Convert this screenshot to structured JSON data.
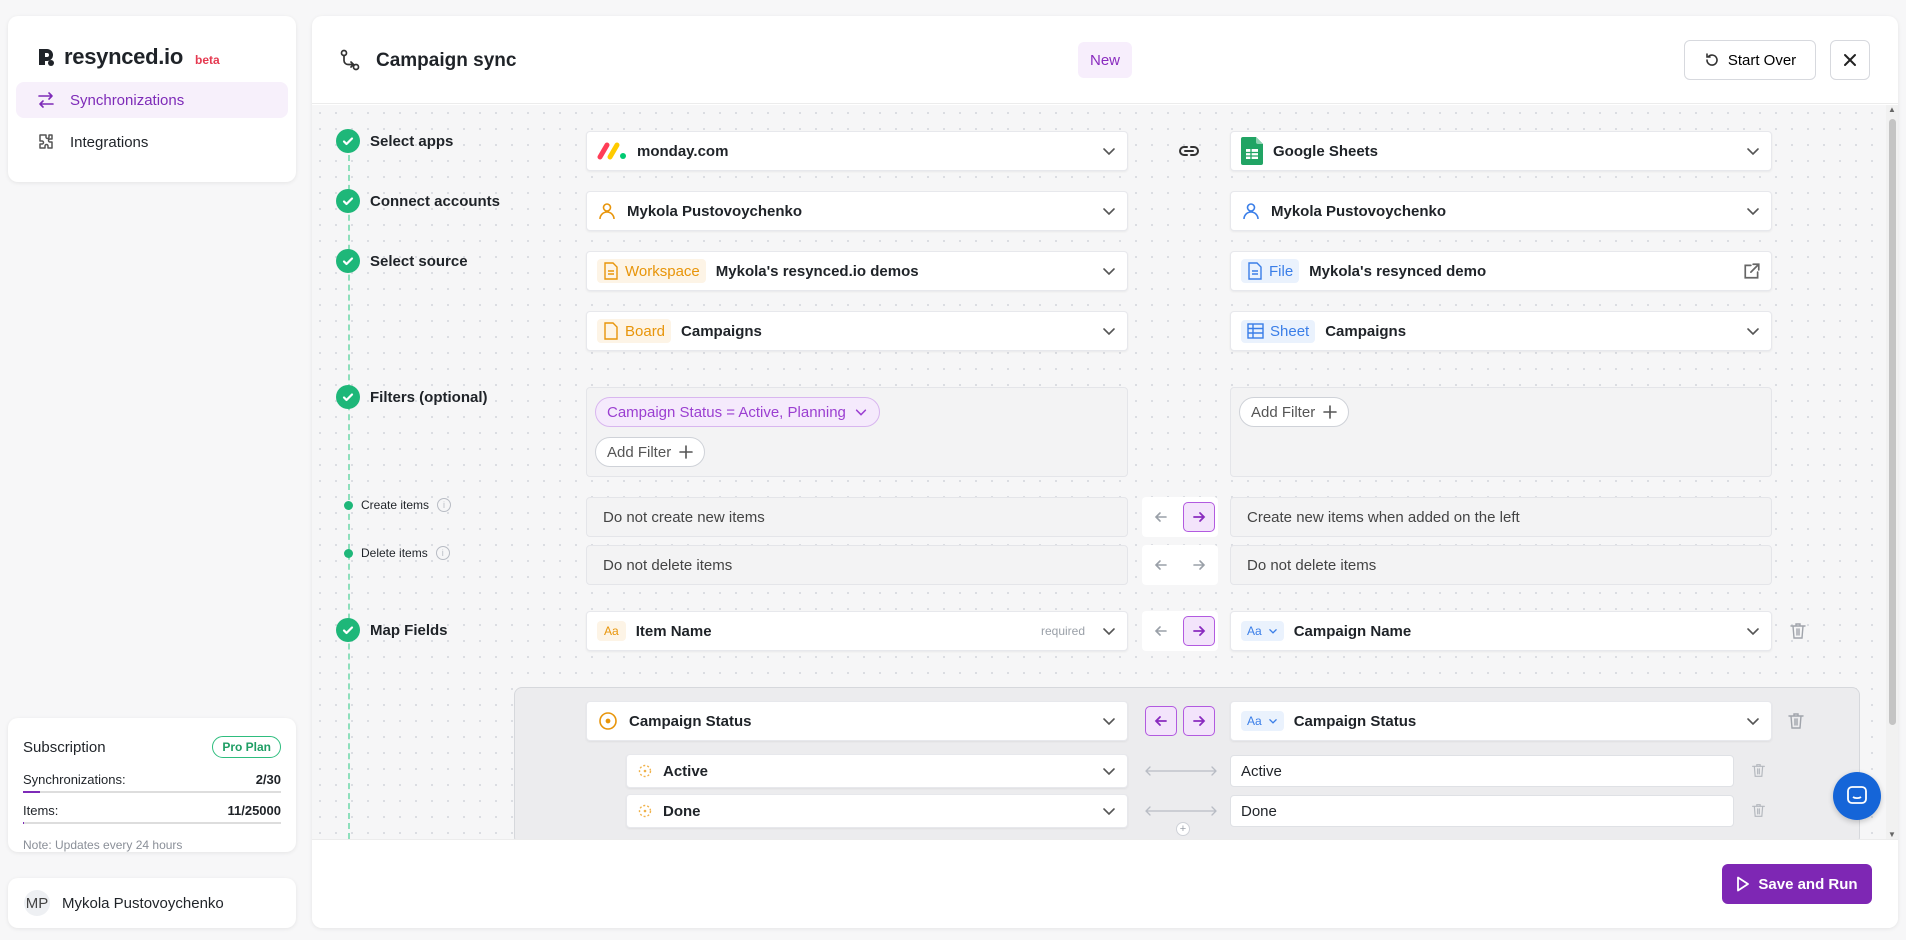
{
  "brand": {
    "name": "resynced.io",
    "beta": "beta",
    "accent": "#7e27b4"
  },
  "nav": [
    {
      "label": "Synchronizations",
      "icon": "sync-arrows-icon",
      "active": true
    },
    {
      "label": "Integrations",
      "icon": "puzzle-icon",
      "active": false
    }
  ],
  "subscription": {
    "title": "Subscription",
    "plan": "Pro Plan",
    "sync_label": "Synchronizations:",
    "sync_value": "2/30",
    "sync_progress": 0.067,
    "items_label": "Items:",
    "items_value": "11/25000",
    "items_progress": 0.0004,
    "note": "Note: Updates every 24 hours"
  },
  "user": {
    "initials": "MP",
    "name": "Mykola Pustovoychenko"
  },
  "header": {
    "title": "Campaign sync",
    "badge": "New",
    "start_over": "Start Over"
  },
  "steps": {
    "select_apps": "Select apps",
    "connect_accounts": "Connect accounts",
    "select_source": "Select source",
    "filters": "Filters (optional)",
    "create_items": "Create items",
    "delete_items": "Delete items",
    "map_fields": "Map Fields"
  },
  "left": {
    "app": "monday.com",
    "account": "Mykola Pustovoychenko",
    "workspace_tag": "Workspace",
    "workspace": "Mykola's resynced.io demos",
    "board_tag": "Board",
    "board": "Campaigns",
    "filter_chip": "Campaign Status = Active, Planning",
    "add_filter": "Add Filter",
    "create_option": "Do not create new items",
    "delete_option": "Do not delete items"
  },
  "right": {
    "app": "Google Sheets",
    "account": "Mykola Pustovoychenko",
    "file_tag": "File",
    "file": "Mykola's resynced demo",
    "sheet_tag": "Sheet",
    "sheet": "Campaigns",
    "add_filter": "Add Filter",
    "create_option": "Create new items when added on the left",
    "delete_option": "Do not delete items"
  },
  "mapping": {
    "row1": {
      "left": "Item Name",
      "required": "required",
      "right": "Campaign Name"
    },
    "row2": {
      "left": "Campaign Status",
      "right": "Campaign Status"
    },
    "values": [
      {
        "left": "Active",
        "right": "Active"
      },
      {
        "left": "Done",
        "right": "Done"
      }
    ]
  },
  "footer": {
    "save_run": "Save and Run"
  }
}
